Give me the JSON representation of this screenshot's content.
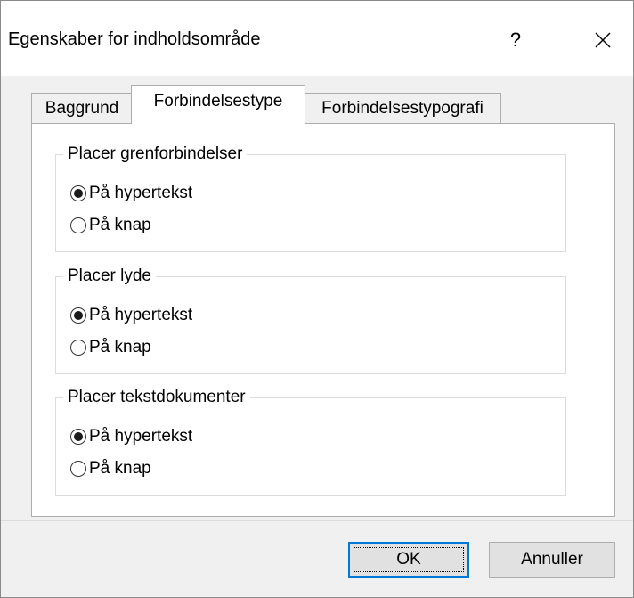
{
  "window": {
    "title": "Egenskaber for indholdsområde",
    "help_label": "?",
    "close_icon": "close-icon"
  },
  "tabs": [
    {
      "label": "Baggrund",
      "active": false
    },
    {
      "label": "Forbindelsestype",
      "active": true
    },
    {
      "label": "Forbindelsestypografi",
      "active": false
    }
  ],
  "groups": [
    {
      "legend": "Placer grenforbindelser",
      "options": [
        {
          "label": "På hypertekst",
          "selected": true
        },
        {
          "label": "På knap",
          "selected": false
        }
      ]
    },
    {
      "legend": "Placer lyde",
      "options": [
        {
          "label": "På hypertekst",
          "selected": true
        },
        {
          "label": "På knap",
          "selected": false
        }
      ]
    },
    {
      "legend": "Placer tekstdokumenter",
      "options": [
        {
          "label": "På hypertekst",
          "selected": true
        },
        {
          "label": "På knap",
          "selected": false
        }
      ]
    }
  ],
  "buttons": {
    "ok_label": "OK",
    "cancel_label": "Annuller"
  },
  "colors": {
    "focus_border": "#0078d7",
    "dialog_bg": "#f0f0f0"
  }
}
